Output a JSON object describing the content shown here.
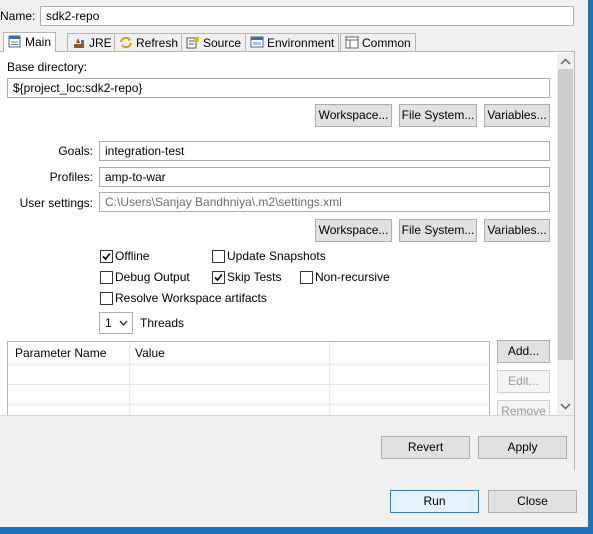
{
  "name_label": "Name:",
  "name_value": "sdk2-repo",
  "tabs": [
    {
      "label": "Main",
      "icon": "main-tab-icon"
    },
    {
      "label": "JRE",
      "icon": "jre-tab-icon"
    },
    {
      "label": "Refresh",
      "icon": "refresh-tab-icon"
    },
    {
      "label": "Source",
      "icon": "source-tab-icon"
    },
    {
      "label": "Environment",
      "icon": "environment-tab-icon"
    },
    {
      "label": "Common",
      "icon": "common-tab-icon"
    }
  ],
  "base_directory": {
    "label": "Base directory:",
    "value": "${project_loc:sdk2-repo}",
    "workspace_btn": "Workspace...",
    "filesystem_btn": "File System...",
    "variables_btn": "Variables..."
  },
  "goals": {
    "label": "Goals:",
    "value": "integration-test"
  },
  "profiles": {
    "label": "Profiles:",
    "value": "amp-to-war"
  },
  "user_settings": {
    "label": "User settings:",
    "value": "C:\\Users\\Sanjay Bandhniya\\.m2\\settings.xml",
    "workspace_btn": "Workspace...",
    "filesystem_btn": "File System...",
    "variables_btn": "Variables..."
  },
  "options": {
    "offline": {
      "label": "Offline",
      "checked": true
    },
    "update_snapshots": {
      "label": "Update Snapshots",
      "checked": false
    },
    "debug_output": {
      "label": "Debug Output",
      "checked": false
    },
    "skip_tests": {
      "label": "Skip Tests",
      "checked": true
    },
    "non_recursive": {
      "label": "Non-recursive",
      "checked": false
    },
    "resolve_workspace": {
      "label": "Resolve Workspace artifacts",
      "checked": false
    }
  },
  "threads": {
    "value": "1",
    "label": "Threads"
  },
  "parameters_table": {
    "columns": [
      "Parameter Name",
      "Value"
    ],
    "add_btn": "Add...",
    "edit_btn": "Edit...",
    "remove_btn": "Remove"
  },
  "revert_btn": "Revert",
  "apply_btn": "Apply",
  "run_btn": "Run",
  "close_btn": "Close",
  "colors": {
    "accent": "#3c7fb1",
    "window_bottom": "#1e73be"
  }
}
